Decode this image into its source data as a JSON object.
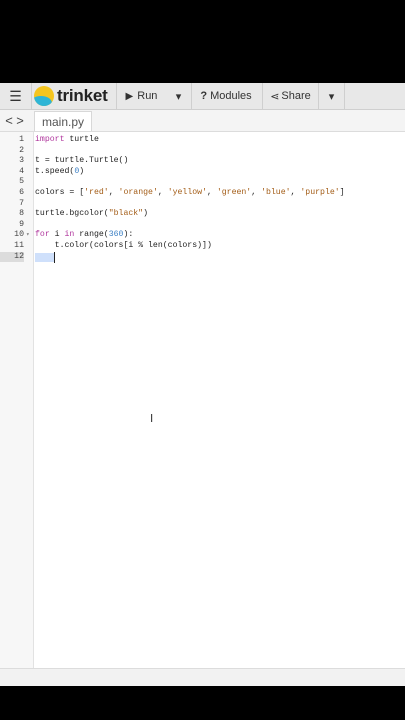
{
  "toolbar": {
    "menu_icon": "☰",
    "brand": "trinket",
    "run_label": "Run",
    "run_icon": "▶",
    "dropdown_icon": "▾",
    "modules_icon": "?",
    "modules_label": "Modules",
    "share_icon": "⋖",
    "share_label": "Share"
  },
  "tabs": {
    "back_icon": "<",
    "forward_icon": ">",
    "file": "main.py"
  },
  "editor": {
    "lines": [
      {
        "n": "1",
        "text": "import turtle"
      },
      {
        "n": "2",
        "text": ""
      },
      {
        "n": "3",
        "text": "t = turtle.Turtle()"
      },
      {
        "n": "4",
        "text": "t.speed(0)"
      },
      {
        "n": "5",
        "text": ""
      },
      {
        "n": "6",
        "text": "colors = ['red', 'orange', 'yellow', 'green', 'blue', 'purple']"
      },
      {
        "n": "7",
        "text": ""
      },
      {
        "n": "8",
        "text": "turtle.bgcolor(\"black\")"
      },
      {
        "n": "9",
        "text": ""
      },
      {
        "n": "10",
        "text": "for i in range(360):"
      },
      {
        "n": "11",
        "text": "    t.color(colors[i % len(colors)])"
      },
      {
        "n": "12",
        "text": "    "
      }
    ]
  },
  "colors": {
    "keyword": "#b0369d",
    "number": "#3b7fc4",
    "string": "#a35c16",
    "logo_yellow": "#f5c51e",
    "logo_blue": "#2fb5d6"
  }
}
